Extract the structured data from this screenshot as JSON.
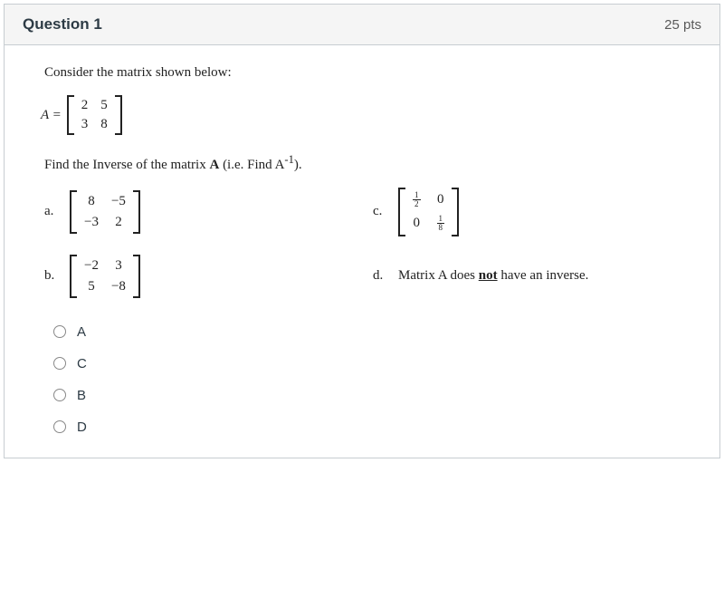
{
  "header": {
    "title": "Question 1",
    "points": "25 pts"
  },
  "prompt": {
    "intro": "Consider the matrix shown below:",
    "lhs": "A =",
    "matrixA": {
      "r1c1": "2",
      "r1c2": "5",
      "r2c1": "3",
      "r2c2": "8"
    },
    "find_1": "Find the Inverse of the matrix ",
    "find_bold": "A",
    "find_2": "  (i.e. Find A",
    "find_sup": "-1",
    "find_3": ")."
  },
  "options": {
    "a": {
      "letter": "a.",
      "m": {
        "r1c1": "8",
        "r1c2": "−5",
        "r2c1": "−3",
        "r2c2": "2"
      }
    },
    "b": {
      "letter": "b.",
      "m": {
        "r1c1": "−2",
        "r1c2": "3",
        "r2c1": "5",
        "r2c2": "−8"
      }
    },
    "c": {
      "letter": "c.",
      "m": {
        "r1c1_num": "1",
        "r1c1_den": "2",
        "r1c2": "0",
        "r2c1": "0",
        "r2c2_num": "1",
        "r2c2_den": "8"
      }
    },
    "d": {
      "letter": "d.",
      "text_pre": "Matrix A does ",
      "text_u": "not",
      "text_post": " have an inverse."
    }
  },
  "answers": {
    "a": "A",
    "c": "C",
    "b": "B",
    "d": "D"
  }
}
